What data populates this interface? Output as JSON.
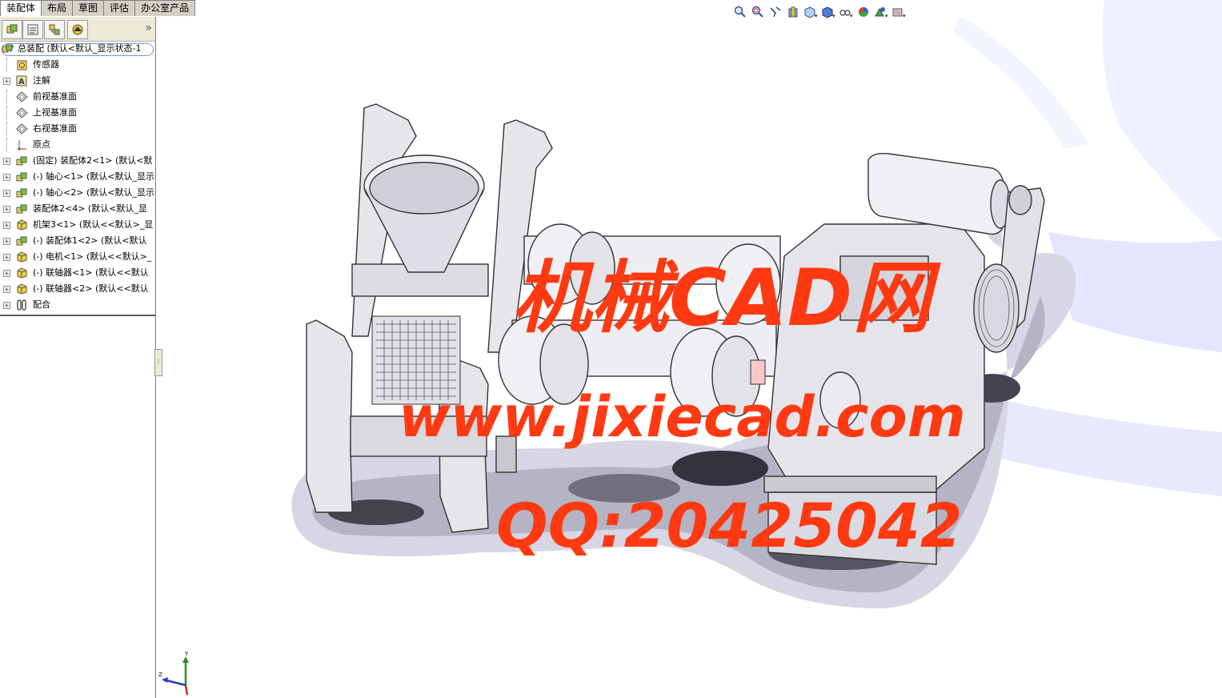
{
  "tabs": [
    "装配体",
    "布局",
    "草图",
    "评估",
    "办公室产品"
  ],
  "active_tab": 0,
  "panel_tabs": [
    "featuremanager-icon",
    "propertymanager-icon",
    "configurationmanager-icon",
    "appearance-icon"
  ],
  "tree": {
    "root": "总装配 (默认<默认_显示状态-1",
    "items": [
      {
        "label": "传感器",
        "icon": "sensor-icon",
        "expand": false
      },
      {
        "label": "注解",
        "icon": "annotation-icon",
        "expand": true
      },
      {
        "label": "前视基准面",
        "icon": "plane-icon",
        "expand": false
      },
      {
        "label": "上视基准面",
        "icon": "plane-icon",
        "expand": false
      },
      {
        "label": "右视基准面",
        "icon": "plane-icon",
        "expand": false
      },
      {
        "label": "原点",
        "icon": "origin-icon",
        "expand": false
      },
      {
        "label": "(固定) 装配体2<1> (默认<默",
        "icon": "assembly-icon",
        "expand": true
      },
      {
        "label": "(-) 轴心<1> (默认<默认_显示",
        "icon": "assembly-icon",
        "expand": true
      },
      {
        "label": "(-) 轴心<2> (默认<默认_显示",
        "icon": "assembly-icon",
        "expand": true
      },
      {
        "label": "装配体2<4> (默认<默认_显",
        "icon": "assembly-icon",
        "expand": true
      },
      {
        "label": "机架3<1> (默认<<默认>_显",
        "icon": "part-icon",
        "expand": true
      },
      {
        "label": "(-) 装配体1<2> (默认<默认",
        "icon": "assembly-icon",
        "expand": true
      },
      {
        "label": "(-) 电机<1> (默认<<默认>_",
        "icon": "part-icon",
        "expand": true
      },
      {
        "label": "(-) 联轴器<1> (默认<<默认",
        "icon": "part-icon",
        "expand": true
      },
      {
        "label": "(-) 联轴器<2> (默认<<默认",
        "icon": "part-icon",
        "expand": true
      },
      {
        "label": "配合",
        "icon": "mates-icon",
        "expand": true
      }
    ]
  },
  "hud_icons": [
    "zoom-to-fit-icon",
    "zoom-area-icon",
    "previous-view-icon",
    "section-view-icon",
    "view-orientation-icon",
    "display-style-icon",
    "hide-show-icon",
    "edit-appearance-icon",
    "apply-scene-icon",
    "view-settings-icon"
  ],
  "watermark": {
    "line1": "机械CAD网",
    "line2": "www.jixiecad.com",
    "line3": "QQ:20425042",
    "color": "#ff3a12"
  },
  "triad": {
    "y": "Y",
    "z": "Z"
  }
}
